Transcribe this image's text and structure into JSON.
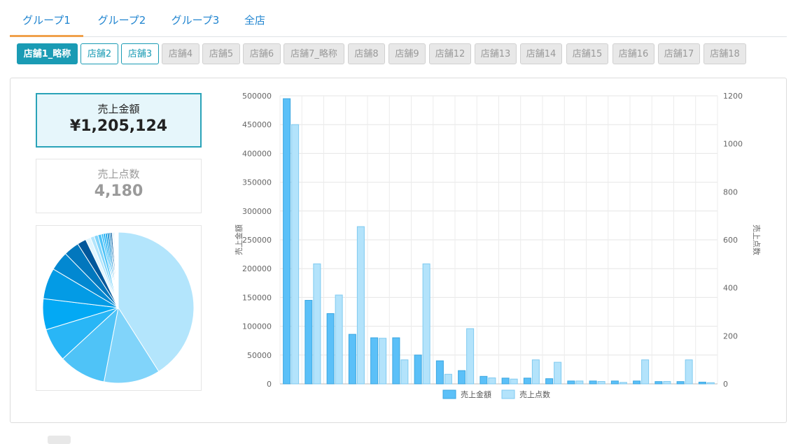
{
  "tabs": [
    "グループ1",
    "グループ2",
    "グループ3",
    "全店"
  ],
  "stores": [
    {
      "label": "店舗1_略称",
      "state": "active"
    },
    {
      "label": "店舗2",
      "state": "selected"
    },
    {
      "label": "店舗3",
      "state": "selected"
    },
    {
      "label": "店舗4",
      "state": "disabled"
    },
    {
      "label": "店舗5",
      "state": "disabled"
    },
    {
      "label": "店舗6",
      "state": "disabled"
    },
    {
      "label": "店舗7_略称",
      "state": "disabled"
    },
    {
      "label": "店舗8",
      "state": "disabled"
    },
    {
      "label": "店舗9",
      "state": "disabled"
    },
    {
      "label": "店舗12",
      "state": "disabled"
    },
    {
      "label": "店舗13",
      "state": "disabled"
    },
    {
      "label": "店舗14",
      "state": "disabled"
    },
    {
      "label": "店舗15",
      "state": "disabled"
    },
    {
      "label": "店舗16",
      "state": "disabled"
    },
    {
      "label": "店舗17",
      "state": "disabled"
    },
    {
      "label": "店舗18",
      "state": "disabled"
    }
  ],
  "kpi": {
    "sales_label": "売上金額",
    "sales_value": "¥1,205,124",
    "qty_label": "売上点数",
    "qty_value": "4,180"
  },
  "colors": {
    "accent": "#1a9bb4",
    "tab_active_underline": "#f0a04b",
    "bar_sales": "#5bc0f8",
    "bar_qty": "#b3e3fb"
  },
  "chart_data": {
    "type": "bar",
    "y_left_label": "売上金額",
    "y_right_label": "売上点数",
    "y_left_range": [
      0,
      500000
    ],
    "y_left_ticks": [
      0,
      50000,
      100000,
      150000,
      200000,
      250000,
      300000,
      350000,
      400000,
      450000,
      500000
    ],
    "y_right_range": [
      0,
      1200
    ],
    "y_right_ticks": [
      0,
      200,
      400,
      600,
      800,
      1000,
      1200
    ],
    "grid": true,
    "legend_position": "bottom",
    "series": [
      {
        "name": "売上金額",
        "axis": "left",
        "values": [
          495000,
          145000,
          122000,
          86000,
          80000,
          80000,
          50000,
          40000,
          23000,
          13000,
          10000,
          10000,
          9000,
          5000,
          5000,
          5000,
          5000,
          4000,
          4000,
          3000
        ]
      },
      {
        "name": "売上点数",
        "axis": "right",
        "values": [
          1080,
          500,
          370,
          655,
          190,
          100,
          500,
          40,
          230,
          25,
          20,
          100,
          90,
          12,
          10,
          6,
          100,
          10,
          100,
          5
        ]
      }
    ],
    "pie": {
      "values": [
        495000,
        145000,
        122000,
        86000,
        80000,
        80000,
        50000,
        40000,
        23000,
        13000,
        10000,
        10000,
        9000,
        5000,
        5000,
        5000,
        5000,
        4000,
        4000,
        3000,
        2500,
        2000,
        1800,
        1500,
        1200,
        1000,
        900,
        700,
        600,
        500
      ],
      "colors": [
        "#b3e5fc",
        "#81d4fa",
        "#4fc3f7",
        "#29b6f6",
        "#03a9f4",
        "#039be5",
        "#0288d1",
        "#0277bd",
        "#01579b",
        "#e1f5fe",
        "#b3e5fc",
        "#81d4fa",
        "#4fc3f7",
        "#29b6f6",
        "#03a9f4",
        "#039be5",
        "#0288d1",
        "#0277bd",
        "#01579b",
        "#e1f5fe"
      ]
    }
  }
}
